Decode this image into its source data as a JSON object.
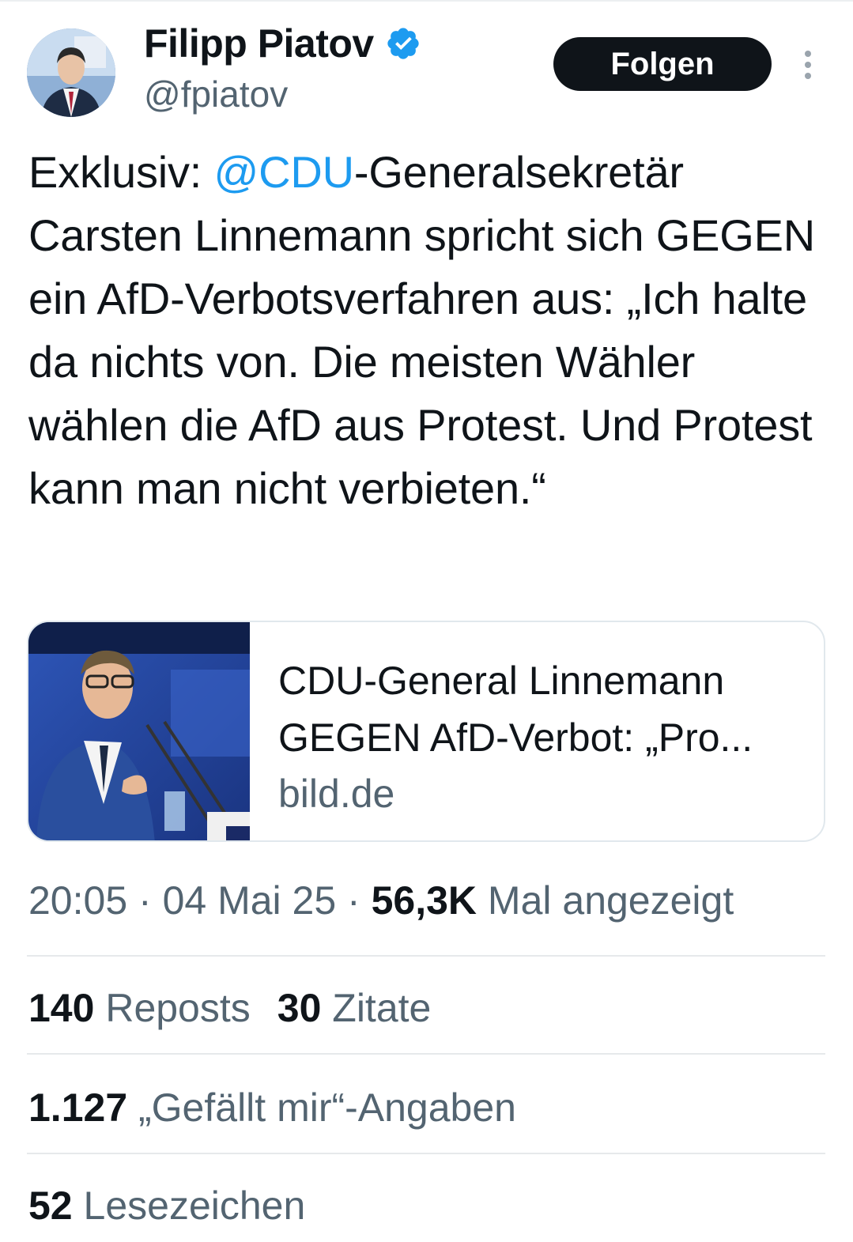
{
  "author": {
    "name": "Filipp Piatov",
    "handle": "@fpiatov",
    "verified_color": "#1d9bf0"
  },
  "follow_label": "Folgen",
  "tweet": {
    "prefix": "Exklusiv: ",
    "mention": "@CDU",
    "body": "-Generalsekretär Carsten Linnemann spricht sich GEGEN ein AfD-Verbotsverfahren aus: „Ich halte da nichts von. Die meisten Wähler wählen die AfD aus Protest. Und Protest kann man nicht verbieten.“"
  },
  "link_card": {
    "title_line1": "CDU-General Linnemann",
    "title_line2": "GEGEN AfD-Verbot: „Pro...",
    "domain": "bild.de"
  },
  "meta": {
    "time": "20:05",
    "sep1": " · ",
    "date": "04 Mai 25",
    "sep2": " · ",
    "views": "56,3K",
    "views_label": " Mal angezeigt"
  },
  "stats": {
    "reposts_count": "140",
    "reposts_label": " Reposts",
    "quotes_count": "30",
    "quotes_label": " Zitate",
    "likes_count": "1.127",
    "likes_label": " „Gefällt mir“-Angaben",
    "bookmarks_count": "52",
    "bookmarks_label": " Lesezeichen"
  },
  "colors": {
    "text": "#0f1419",
    "secondary": "#536471",
    "link": "#1d9bf0"
  }
}
